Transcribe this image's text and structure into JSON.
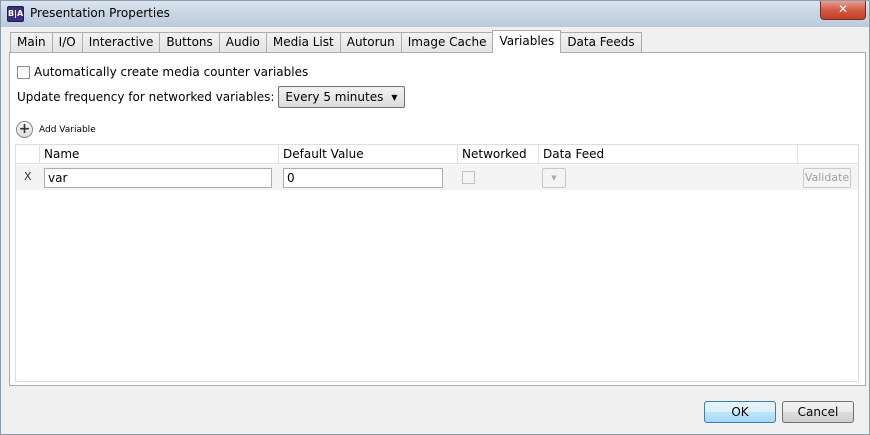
{
  "window": {
    "title": "Presentation Properties",
    "icon_text": "B|A",
    "close_glyph": "✕"
  },
  "tabs": [
    {
      "label": "Main"
    },
    {
      "label": "I/O"
    },
    {
      "label": "Interactive"
    },
    {
      "label": "Buttons"
    },
    {
      "label": "Audio"
    },
    {
      "label": "Media List"
    },
    {
      "label": "Autorun"
    },
    {
      "label": "Image Cache"
    },
    {
      "label": "Variables",
      "active": true
    },
    {
      "label": "Data Feeds"
    }
  ],
  "variables": {
    "auto_counter_label": "Automatically create media counter variables",
    "auto_counter_checked": false,
    "update_freq_label": "Update frequency for networked variables:",
    "update_freq_value": "Every 5 minutes",
    "add_variable_label": "Add Variable",
    "columns": [
      "Name",
      "Default Value",
      "Networked",
      "Data Feed"
    ],
    "rows": [
      {
        "delete_label": "X",
        "name": "var",
        "default_value": "0",
        "networked": false,
        "validate_label": "Validate"
      }
    ]
  },
  "footer": {
    "ok_label": "OK",
    "cancel_label": "Cancel"
  },
  "colors": {
    "accent": "#3c7fb1",
    "close": "#c4402a"
  }
}
